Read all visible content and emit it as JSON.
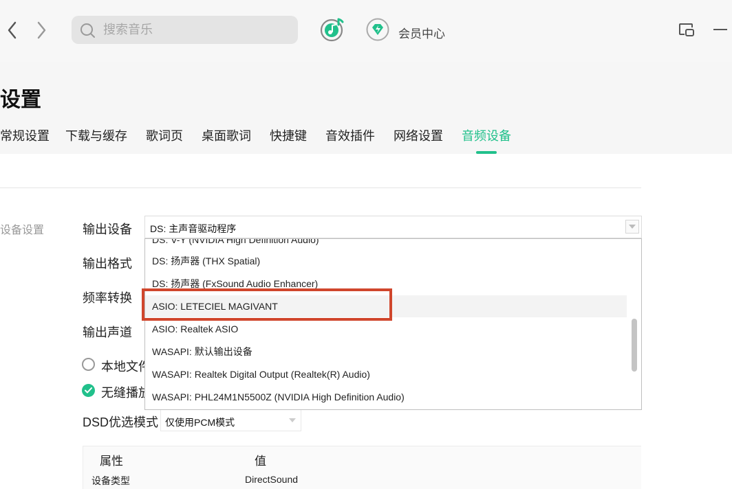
{
  "search": {
    "placeholder": "搜索音乐"
  },
  "topbar": {
    "vip_label": "会员中心"
  },
  "page": {
    "title": "设置"
  },
  "tabs": [
    {
      "label": "常规设置"
    },
    {
      "label": "下载与缓存"
    },
    {
      "label": "歌词页"
    },
    {
      "label": "桌面歌词"
    },
    {
      "label": "快捷键"
    },
    {
      "label": "音效插件"
    },
    {
      "label": "网络设置"
    },
    {
      "label": "音频设备",
      "active": true
    }
  ],
  "section": {
    "label": "设备设置"
  },
  "settings": {
    "output_device_label": "输出设备",
    "output_device_value": "DS: 主声音驱动程序",
    "output_format_label": "输出格式",
    "sample_rate_label": "频率转换",
    "output_channel_label": "输出声道",
    "local_file_label": "本地文件",
    "gapless_label": "无缝播放",
    "dsd_label": "DSD优选模式",
    "dsd_value": "仅使用PCM模式"
  },
  "dropdown": {
    "options": [
      {
        "label": "DS: V-Y (NVIDIA High Definition Audio)"
      },
      {
        "label": "DS: 扬声器 (THX Spatial)"
      },
      {
        "label": "DS: 扬声器 (FxSound Audio Enhancer)"
      },
      {
        "label": "ASIO: LETECIEL MAGIVANT",
        "hovered": true,
        "highlighted": true
      },
      {
        "label": "ASIO: Realtek ASIO"
      },
      {
        "label": "WASAPI: 默认输出设备"
      },
      {
        "label": "WASAPI: Realtek Digital Output (Realtek(R) Audio)"
      },
      {
        "label": "WASAPI: PHL24M1N5500Z (NVIDIA High Definition Audio)"
      }
    ]
  },
  "table": {
    "headers": [
      "属性",
      "值"
    ],
    "rows": [
      [
        "设备类型",
        "DirectSound"
      ]
    ]
  },
  "colors": {
    "accent": "#21c08b",
    "highlight_box": "#d0462c"
  }
}
